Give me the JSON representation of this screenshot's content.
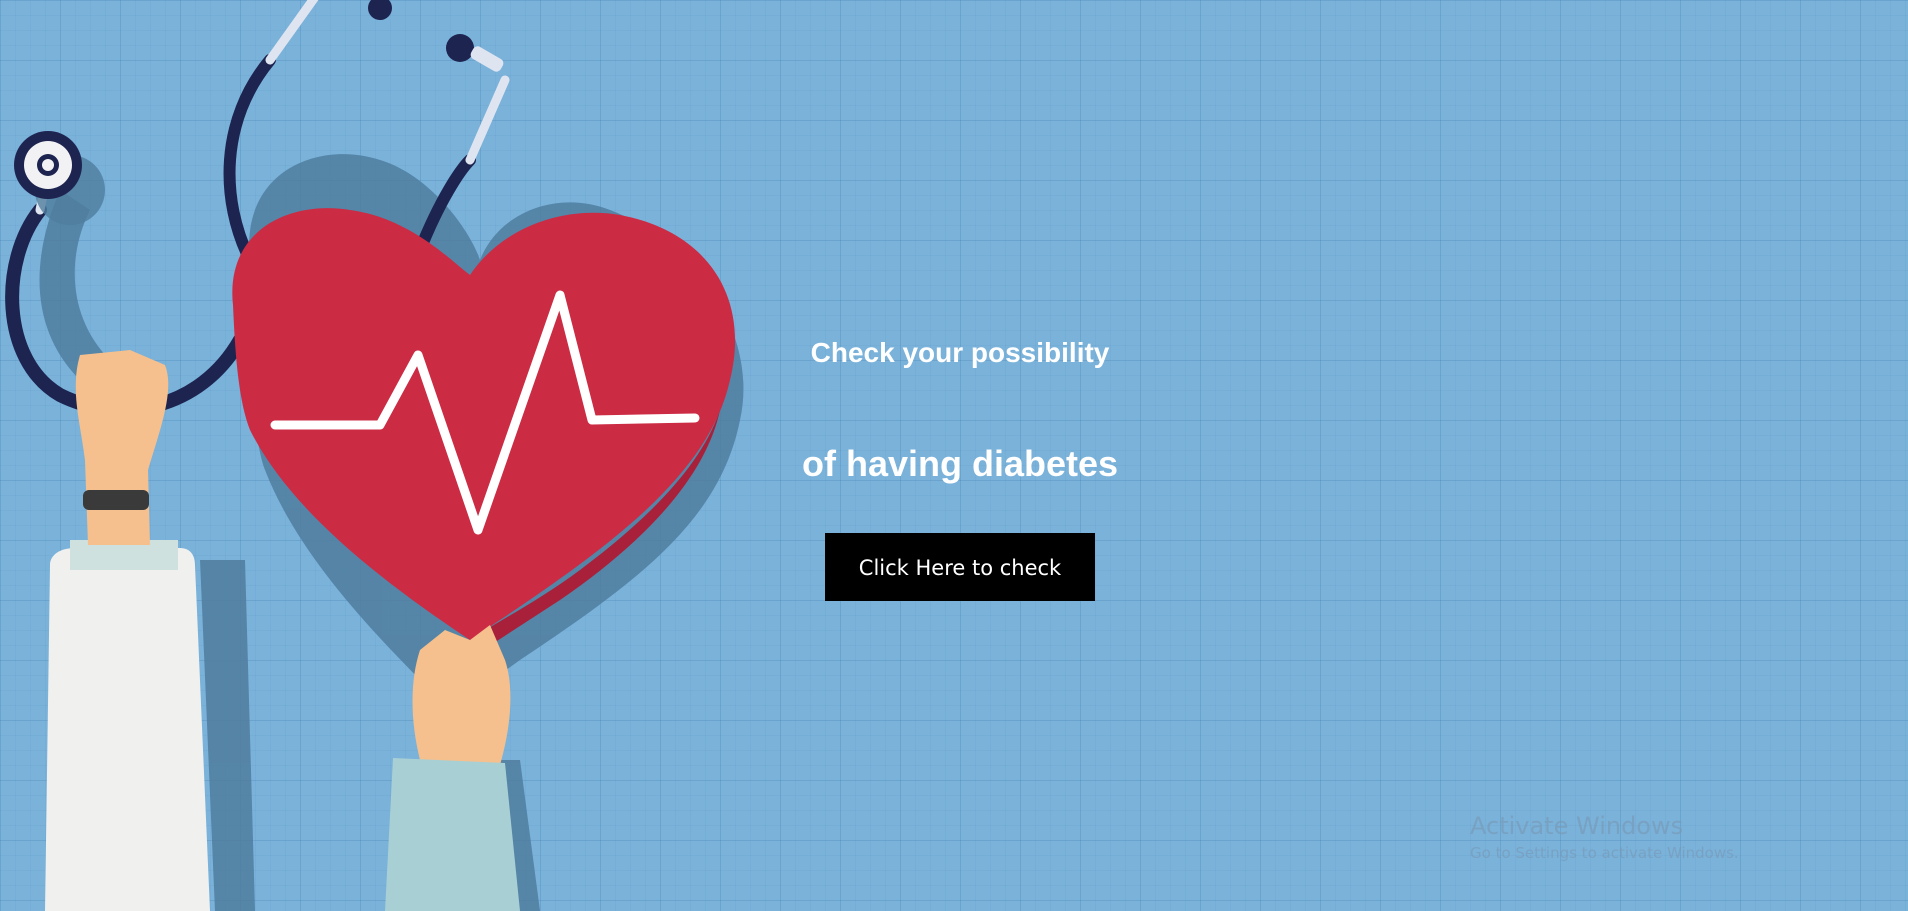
{
  "hero": {
    "line1": "Check your possibility",
    "line2": "of having diabetes",
    "button_label": "Click Here to check"
  },
  "watermark": {
    "title": "Activate Windows",
    "subtitle": "Go to Settings to activate Windows."
  },
  "illustration": {
    "icons": [
      "stethoscope-icon",
      "heart-icon",
      "heartbeat-line-icon"
    ],
    "colors": {
      "background": "#7ab2da",
      "heart": "#cc2b44",
      "tubing": "#1d2450",
      "coat": "#f0f0ee",
      "sleeve": "#a8cfd3",
      "skin": "#f5c08e"
    }
  }
}
